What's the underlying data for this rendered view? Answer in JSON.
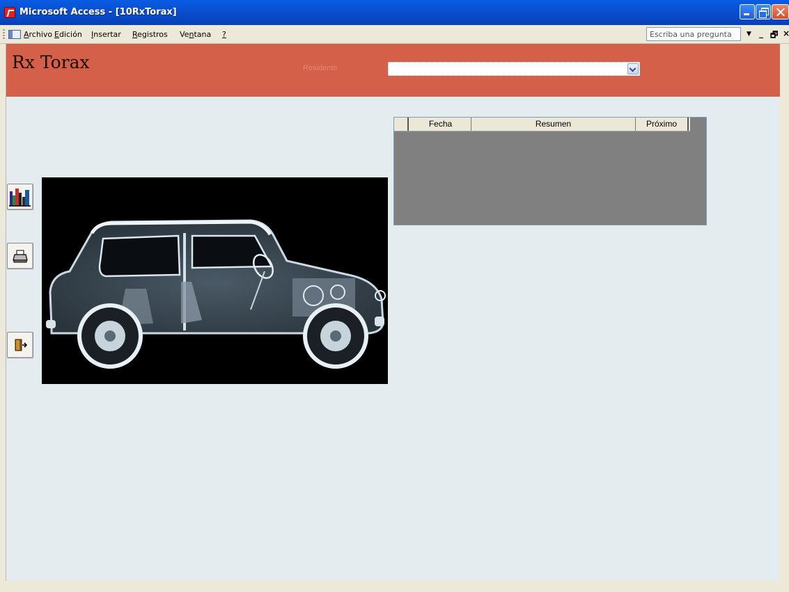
{
  "window": {
    "title": "Microsoft Access - [10RxTorax]"
  },
  "menu": {
    "items": [
      {
        "pre": "",
        "u": "A",
        "post": "rchivo"
      },
      {
        "pre": "",
        "u": "E",
        "post": "dición"
      },
      {
        "pre": "",
        "u": "I",
        "post": "nsertar"
      },
      {
        "pre": "",
        "u": "R",
        "post": "egistros"
      },
      {
        "pre": "Ve",
        "u": "n",
        "post": "tana"
      },
      {
        "pre": "",
        "u": "?",
        "post": ""
      }
    ],
    "ask_placeholder": "Escriba una pregunta"
  },
  "form": {
    "title": "Rx Torax",
    "resident_label": "Residente",
    "resident_value": "",
    "header_color": "#d4604a",
    "background_color": "#e4ecf0"
  },
  "side_buttons": [
    {
      "name": "chart-button",
      "icon": "bar-chart-icon"
    },
    {
      "name": "print-button",
      "icon": "printer-icon"
    },
    {
      "name": "exit-button",
      "icon": "exit-door-icon"
    }
  ],
  "subform": {
    "columns": [
      "Fecha",
      "Resumen",
      "Próximo"
    ],
    "rows": []
  },
  "image": {
    "subject": "x-ray-car-image"
  }
}
